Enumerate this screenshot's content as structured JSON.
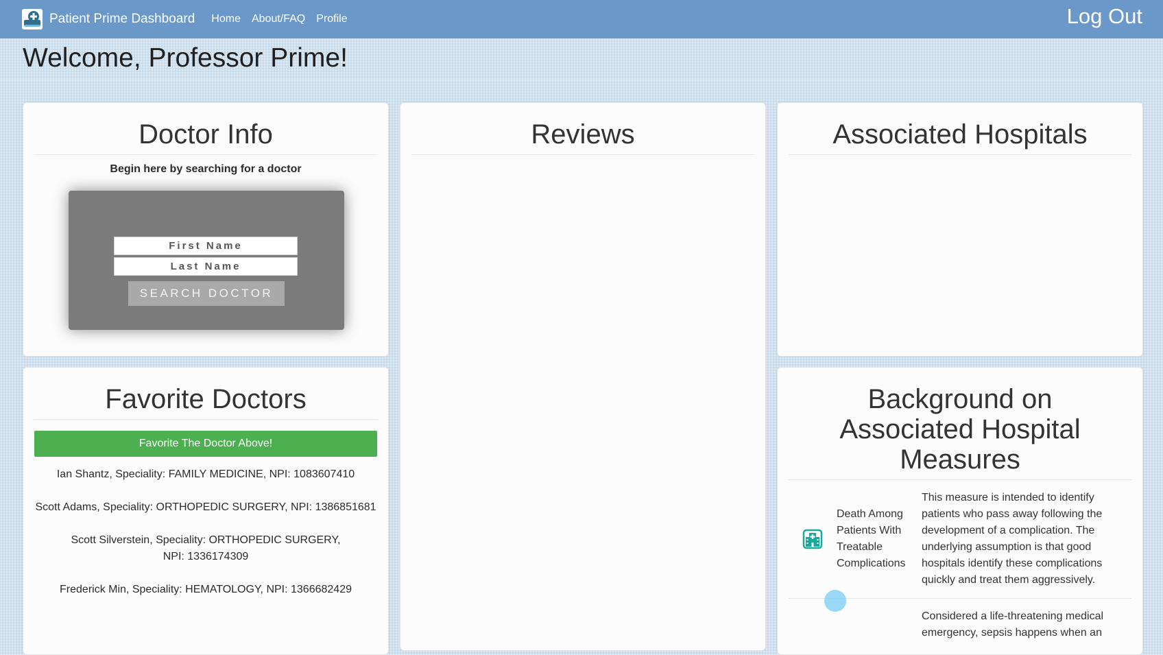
{
  "navbar": {
    "brand_title": "Patient Prime Dashboard",
    "logo_icon": "medical-plus-icon",
    "links": [
      "Home",
      "About/FAQ",
      "Profile"
    ],
    "logout_label": "Log Out",
    "color": "#6a98c8"
  },
  "welcome": "Welcome, Professor Prime!",
  "doctor_info": {
    "title": "Doctor Info",
    "hint": "Begin here by searching for a doctor",
    "first_name_placeholder": "First Name",
    "last_name_placeholder": "Last Name",
    "search_button": "SEARCH DOCTOR"
  },
  "reviews": {
    "title": "Reviews"
  },
  "hospitals": {
    "title": "Associated Hospitals"
  },
  "favorites": {
    "title": "Favorite Doctors",
    "button": "Favorite The Doctor Above!",
    "button_color": "#4caf50",
    "items": [
      "Ian Shantz, Speciality: FAMILY MEDICINE, NPI: 1083607410",
      "Scott Adams, Speciality: ORTHOPEDIC SURGERY, NPI: 1386851681",
      "Scott Silverstein, Speciality: ORTHOPEDIC SURGERY, NPI: 1336174309",
      "Frederick Min, Speciality: HEMATOLOGY, NPI: 1366682429"
    ]
  },
  "background": {
    "title": "Background on Associated Hospital Measures",
    "measures": [
      {
        "icon": "hospital-icon",
        "name": "Death Among Patients With Treatable Complications",
        "description": "This measure is intended to identify patients who pass away following the development of a complication. The underlying assumption is that good hospitals identify these complications quickly and treat them aggressively."
      },
      {
        "name": "",
        "description": "Considered a life-threatening medical emergency, sepsis happens when an"
      }
    ],
    "icon_color": "#1aa89a"
  }
}
